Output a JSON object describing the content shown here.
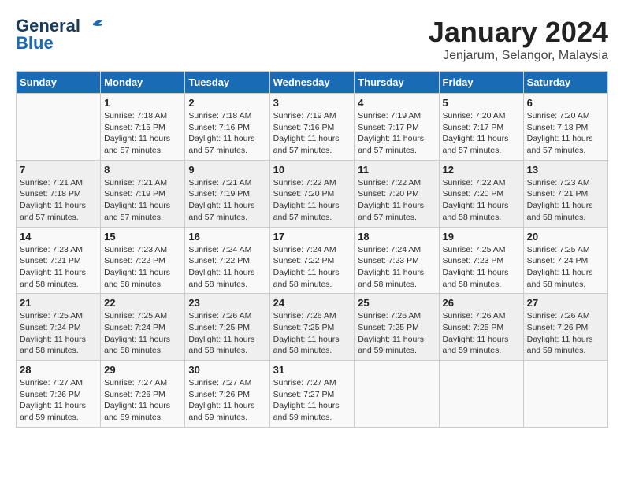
{
  "header": {
    "logo_line1": "General",
    "logo_line2": "Blue",
    "title": "January 2024",
    "subtitle": "Jenjarum, Selangor, Malaysia"
  },
  "columns": [
    "Sunday",
    "Monday",
    "Tuesday",
    "Wednesday",
    "Thursday",
    "Friday",
    "Saturday"
  ],
  "weeks": [
    [
      {
        "day": "",
        "info": ""
      },
      {
        "day": "1",
        "info": "Sunrise: 7:18 AM\nSunset: 7:15 PM\nDaylight: 11 hours\nand 57 minutes."
      },
      {
        "day": "2",
        "info": "Sunrise: 7:18 AM\nSunset: 7:16 PM\nDaylight: 11 hours\nand 57 minutes."
      },
      {
        "day": "3",
        "info": "Sunrise: 7:19 AM\nSunset: 7:16 PM\nDaylight: 11 hours\nand 57 minutes."
      },
      {
        "day": "4",
        "info": "Sunrise: 7:19 AM\nSunset: 7:17 PM\nDaylight: 11 hours\nand 57 minutes."
      },
      {
        "day": "5",
        "info": "Sunrise: 7:20 AM\nSunset: 7:17 PM\nDaylight: 11 hours\nand 57 minutes."
      },
      {
        "day": "6",
        "info": "Sunrise: 7:20 AM\nSunset: 7:18 PM\nDaylight: 11 hours\nand 57 minutes."
      }
    ],
    [
      {
        "day": "7",
        "info": "Sunrise: 7:21 AM\nSunset: 7:18 PM\nDaylight: 11 hours\nand 57 minutes."
      },
      {
        "day": "8",
        "info": "Sunrise: 7:21 AM\nSunset: 7:19 PM\nDaylight: 11 hours\nand 57 minutes."
      },
      {
        "day": "9",
        "info": "Sunrise: 7:21 AM\nSunset: 7:19 PM\nDaylight: 11 hours\nand 57 minutes."
      },
      {
        "day": "10",
        "info": "Sunrise: 7:22 AM\nSunset: 7:20 PM\nDaylight: 11 hours\nand 57 minutes."
      },
      {
        "day": "11",
        "info": "Sunrise: 7:22 AM\nSunset: 7:20 PM\nDaylight: 11 hours\nand 57 minutes."
      },
      {
        "day": "12",
        "info": "Sunrise: 7:22 AM\nSunset: 7:20 PM\nDaylight: 11 hours\nand 58 minutes."
      },
      {
        "day": "13",
        "info": "Sunrise: 7:23 AM\nSunset: 7:21 PM\nDaylight: 11 hours\nand 58 minutes."
      }
    ],
    [
      {
        "day": "14",
        "info": "Sunrise: 7:23 AM\nSunset: 7:21 PM\nDaylight: 11 hours\nand 58 minutes."
      },
      {
        "day": "15",
        "info": "Sunrise: 7:23 AM\nSunset: 7:22 PM\nDaylight: 11 hours\nand 58 minutes."
      },
      {
        "day": "16",
        "info": "Sunrise: 7:24 AM\nSunset: 7:22 PM\nDaylight: 11 hours\nand 58 minutes."
      },
      {
        "day": "17",
        "info": "Sunrise: 7:24 AM\nSunset: 7:22 PM\nDaylight: 11 hours\nand 58 minutes."
      },
      {
        "day": "18",
        "info": "Sunrise: 7:24 AM\nSunset: 7:23 PM\nDaylight: 11 hours\nand 58 minutes."
      },
      {
        "day": "19",
        "info": "Sunrise: 7:25 AM\nSunset: 7:23 PM\nDaylight: 11 hours\nand 58 minutes."
      },
      {
        "day": "20",
        "info": "Sunrise: 7:25 AM\nSunset: 7:24 PM\nDaylight: 11 hours\nand 58 minutes."
      }
    ],
    [
      {
        "day": "21",
        "info": "Sunrise: 7:25 AM\nSunset: 7:24 PM\nDaylight: 11 hours\nand 58 minutes."
      },
      {
        "day": "22",
        "info": "Sunrise: 7:25 AM\nSunset: 7:24 PM\nDaylight: 11 hours\nand 58 minutes."
      },
      {
        "day": "23",
        "info": "Sunrise: 7:26 AM\nSunset: 7:25 PM\nDaylight: 11 hours\nand 58 minutes."
      },
      {
        "day": "24",
        "info": "Sunrise: 7:26 AM\nSunset: 7:25 PM\nDaylight: 11 hours\nand 58 minutes."
      },
      {
        "day": "25",
        "info": "Sunrise: 7:26 AM\nSunset: 7:25 PM\nDaylight: 11 hours\nand 59 minutes."
      },
      {
        "day": "26",
        "info": "Sunrise: 7:26 AM\nSunset: 7:25 PM\nDaylight: 11 hours\nand 59 minutes."
      },
      {
        "day": "27",
        "info": "Sunrise: 7:26 AM\nSunset: 7:26 PM\nDaylight: 11 hours\nand 59 minutes."
      }
    ],
    [
      {
        "day": "28",
        "info": "Sunrise: 7:27 AM\nSunset: 7:26 PM\nDaylight: 11 hours\nand 59 minutes."
      },
      {
        "day": "29",
        "info": "Sunrise: 7:27 AM\nSunset: 7:26 PM\nDaylight: 11 hours\nand 59 minutes."
      },
      {
        "day": "30",
        "info": "Sunrise: 7:27 AM\nSunset: 7:26 PM\nDaylight: 11 hours\nand 59 minutes."
      },
      {
        "day": "31",
        "info": "Sunrise: 7:27 AM\nSunset: 7:27 PM\nDaylight: 11 hours\nand 59 minutes."
      },
      {
        "day": "",
        "info": ""
      },
      {
        "day": "",
        "info": ""
      },
      {
        "day": "",
        "info": ""
      }
    ]
  ]
}
